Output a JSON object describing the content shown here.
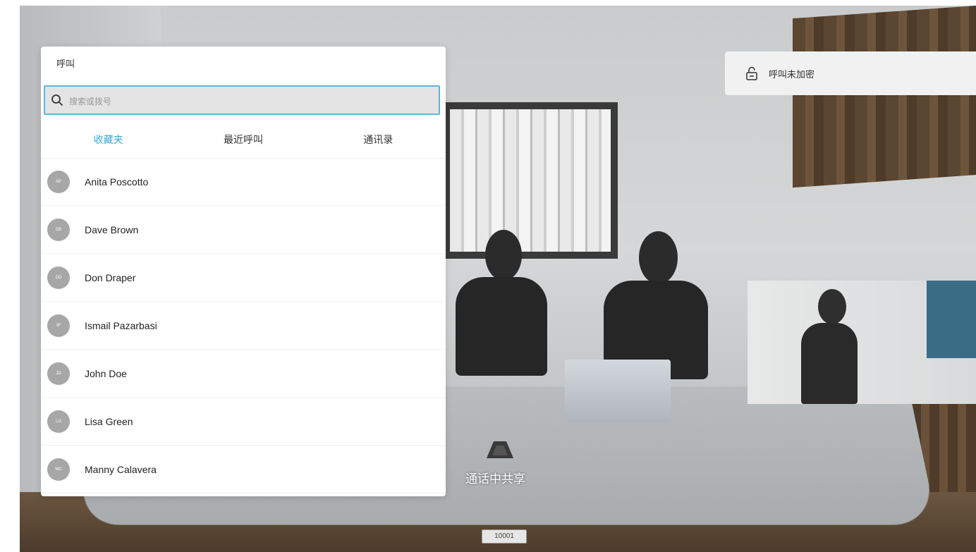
{
  "call_panel": {
    "title": "呼叫",
    "search_placeholder": "搜索或拨号",
    "tabs": [
      {
        "label": "收藏夹",
        "active": true
      },
      {
        "label": "最近呼叫",
        "active": false
      },
      {
        "label": "通讯录",
        "active": false
      }
    ],
    "contacts": [
      {
        "initials": "AP",
        "name": "Anita Poscotto"
      },
      {
        "initials": "DB",
        "name": "Dave Brown"
      },
      {
        "initials": "DD",
        "name": "Don Draper"
      },
      {
        "initials": "IP",
        "name": "Ismail Pazarbasi"
      },
      {
        "initials": "JD",
        "name": "John Doe"
      },
      {
        "initials": "LG",
        "name": "Lisa Green"
      },
      {
        "initials": "MC",
        "name": "Manny Calavera"
      }
    ]
  },
  "encryption": {
    "icon": "unlock-icon",
    "label": "呼叫未加密"
  },
  "share_in_call": {
    "icon": "share-icon",
    "label": "通话中共享"
  },
  "device_number": "10001",
  "colors": {
    "accent": "#3aa8d8",
    "avatar": "#a7a7a7"
  }
}
